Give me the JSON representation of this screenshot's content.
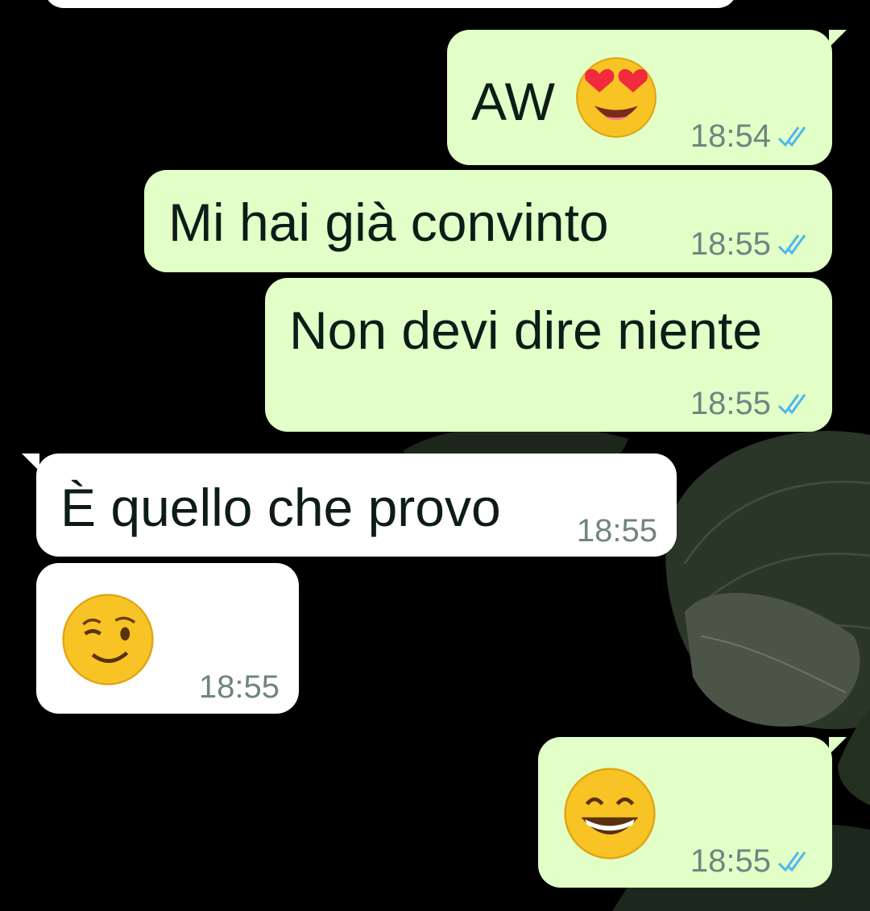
{
  "colors": {
    "outgoing_bubble": "#e1ffc7",
    "incoming_bubble": "#ffffff",
    "timestamp": "#6f8580",
    "read_ticks": "#4fb6ec",
    "background": "#000000"
  },
  "messages": [
    {
      "direction": "out",
      "text": "AW",
      "emoji": "smiling-face-with-heart-eyes",
      "time": "18:54",
      "status": "read"
    },
    {
      "direction": "out",
      "text": "Mi hai già convinto",
      "time": "18:55",
      "status": "read"
    },
    {
      "direction": "out",
      "text": "Non devi dire niente",
      "time": "18:55",
      "status": "read"
    },
    {
      "direction": "in",
      "text": "È quello che provo",
      "time": "18:55"
    },
    {
      "direction": "in",
      "text": "",
      "emoji": "winking-face",
      "time": "18:55"
    },
    {
      "direction": "out",
      "text": "",
      "emoji": "grinning-face-with-smiling-eyes",
      "time": "18:55",
      "status": "read"
    }
  ]
}
